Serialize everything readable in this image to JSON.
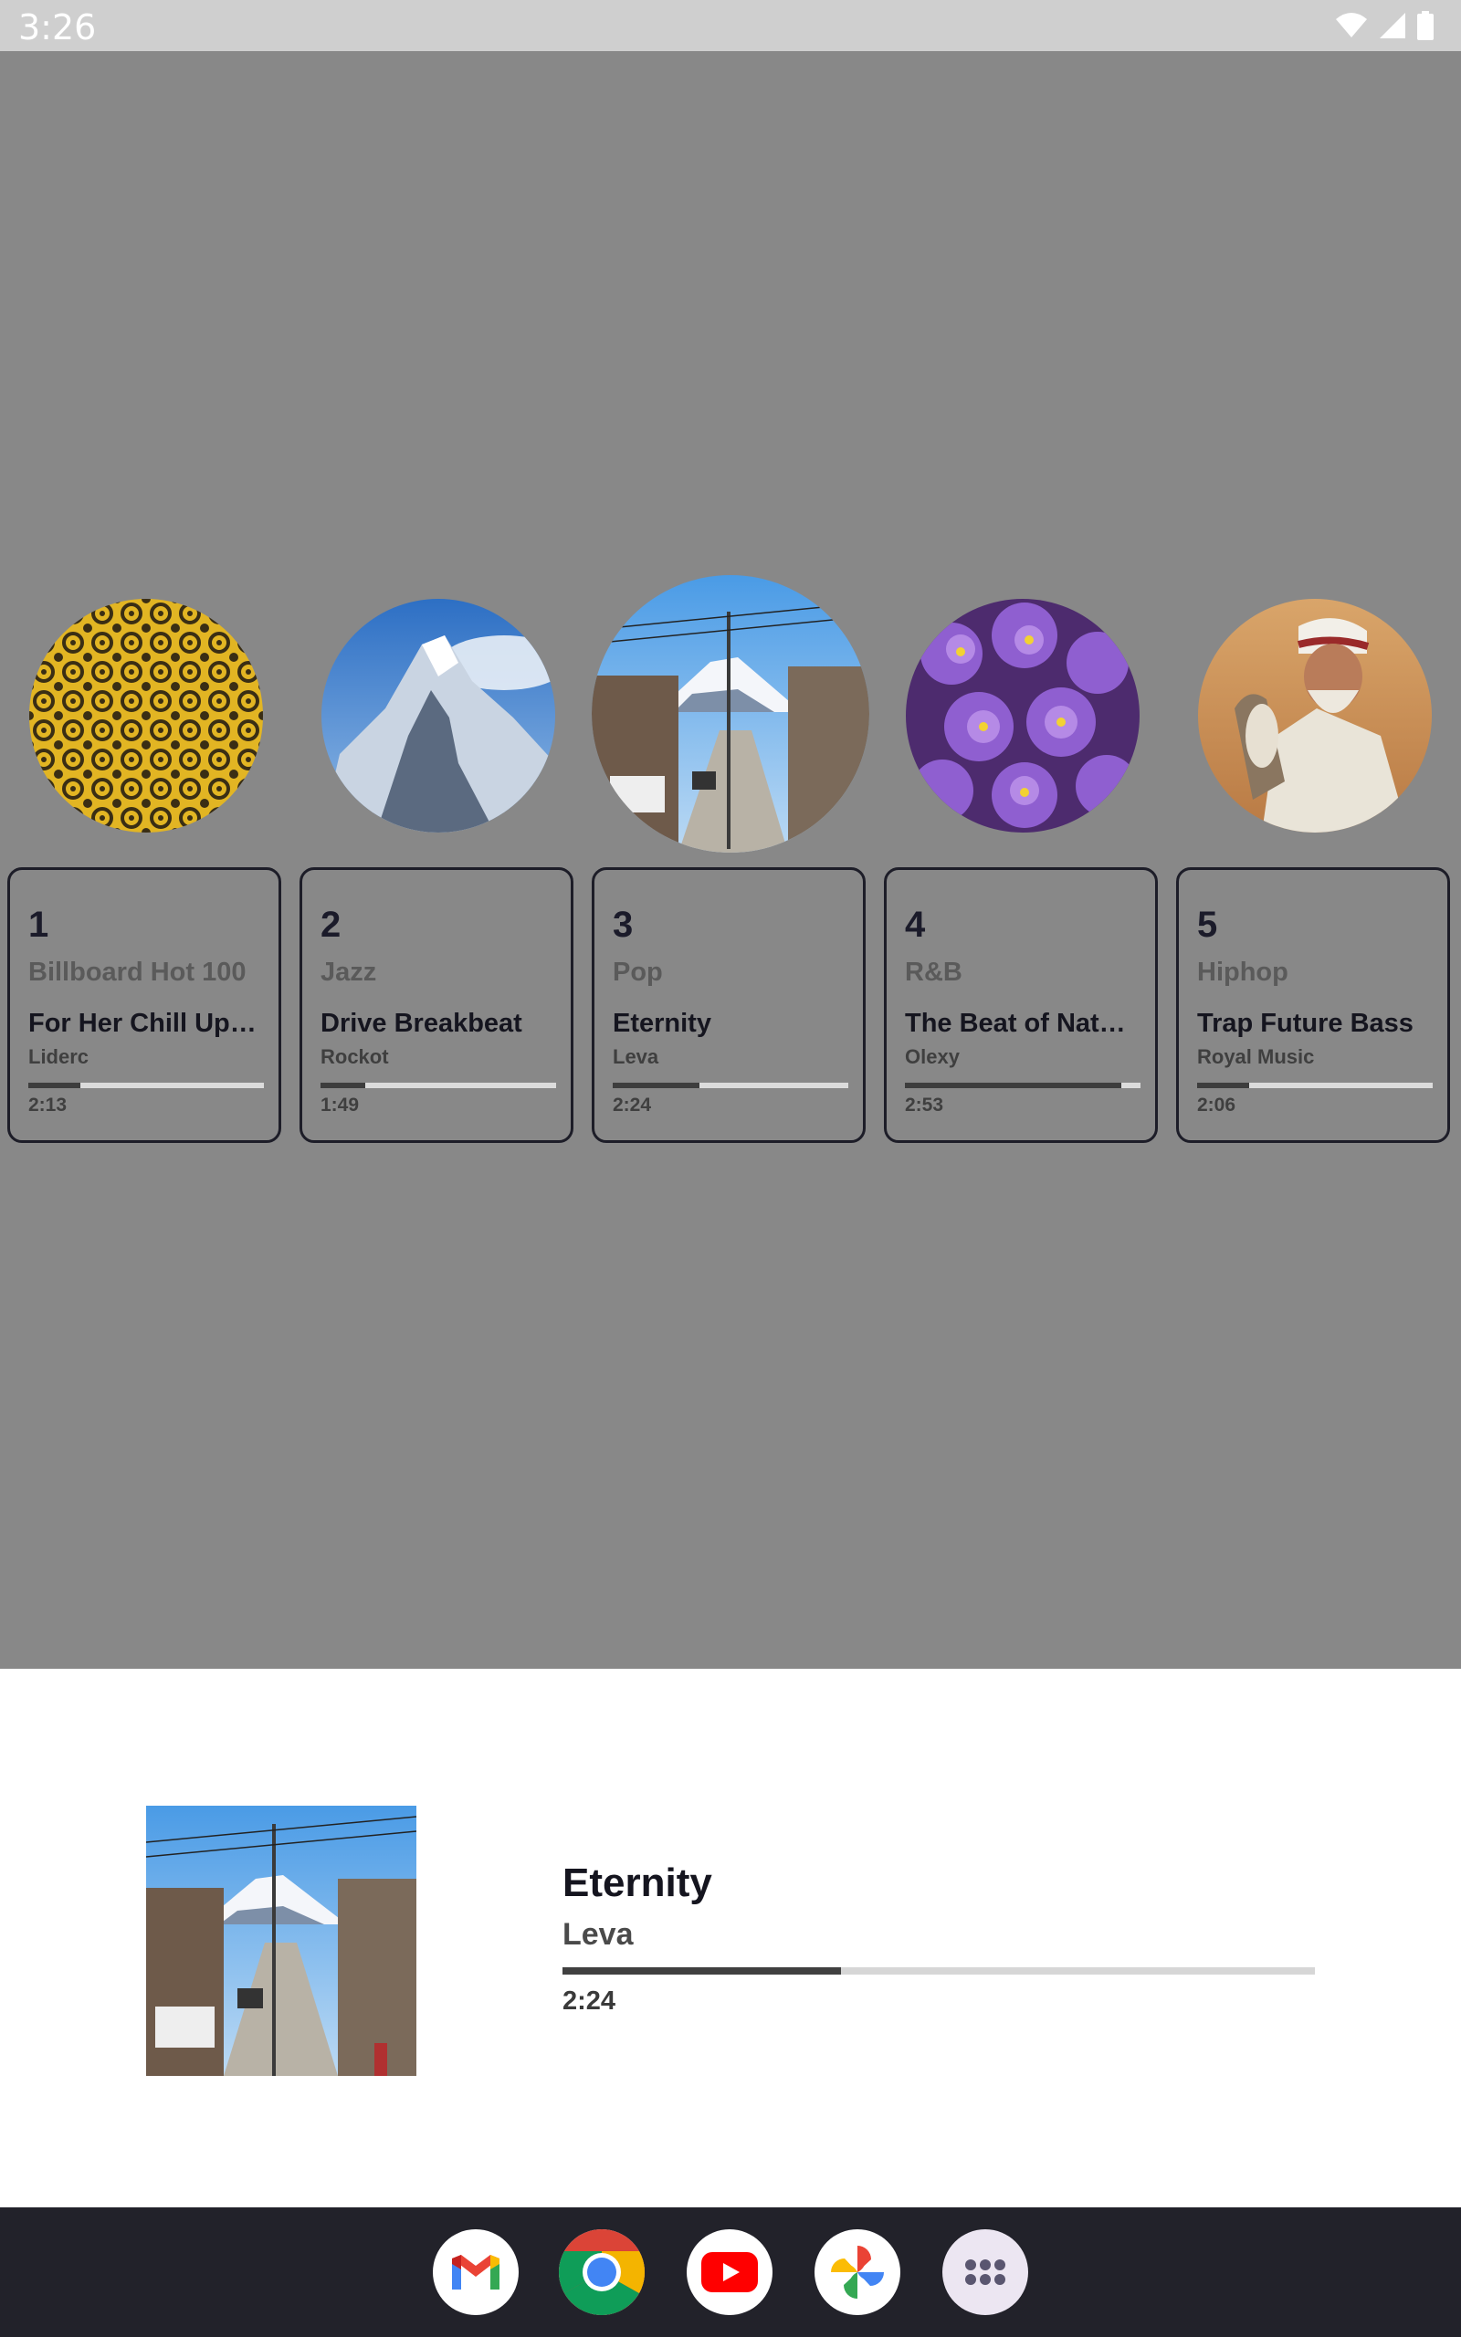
{
  "status_bar": {
    "time": "3:26",
    "icons": [
      "wifi-icon",
      "cellular-signal-icon",
      "battery-icon"
    ]
  },
  "carousel": [
    {
      "rank": "1",
      "genre": "Billboard Hot 100",
      "song": "For Her Chill Up…",
      "artist": "Liderc",
      "duration": "2:13",
      "progress": 0.22,
      "art": "yellow-pattern"
    },
    {
      "rank": "2",
      "genre": "Jazz",
      "song": "Drive Breakbeat",
      "artist": "Rockot",
      "duration": "1:49",
      "progress": 0.19,
      "art": "snowy-mountain"
    },
    {
      "rank": "3",
      "genre": "Pop",
      "song": "Eternity",
      "artist": "Leva",
      "duration": "2:24",
      "progress": 0.37,
      "art": "street-with-mount-fuji",
      "selected": true
    },
    {
      "rank": "4",
      "genre": "R&B",
      "song": "The Beat of Nat…",
      "artist": "Olexy",
      "duration": "2:53",
      "progress": 0.92,
      "art": "purple-flowers"
    },
    {
      "rank": "5",
      "genre": "Hiphop",
      "song": "Trap Future Bass",
      "artist": "Royal Music",
      "duration": "2:06",
      "progress": 0.22,
      "art": "man-with-falcon"
    }
  ],
  "now_playing": {
    "title": "Eternity",
    "artist": "Leva",
    "duration": "2:24",
    "progress": 0.37
  },
  "dock": [
    "gmail-icon",
    "chrome-icon",
    "youtube-icon",
    "photos-icon",
    "app-drawer-icon"
  ],
  "colors": {
    "background": "#888888",
    "panel": "#ffffff",
    "dock": "#22222a",
    "progress_fill": "#3d3d3d",
    "progress_track": "#dcdcdc"
  }
}
